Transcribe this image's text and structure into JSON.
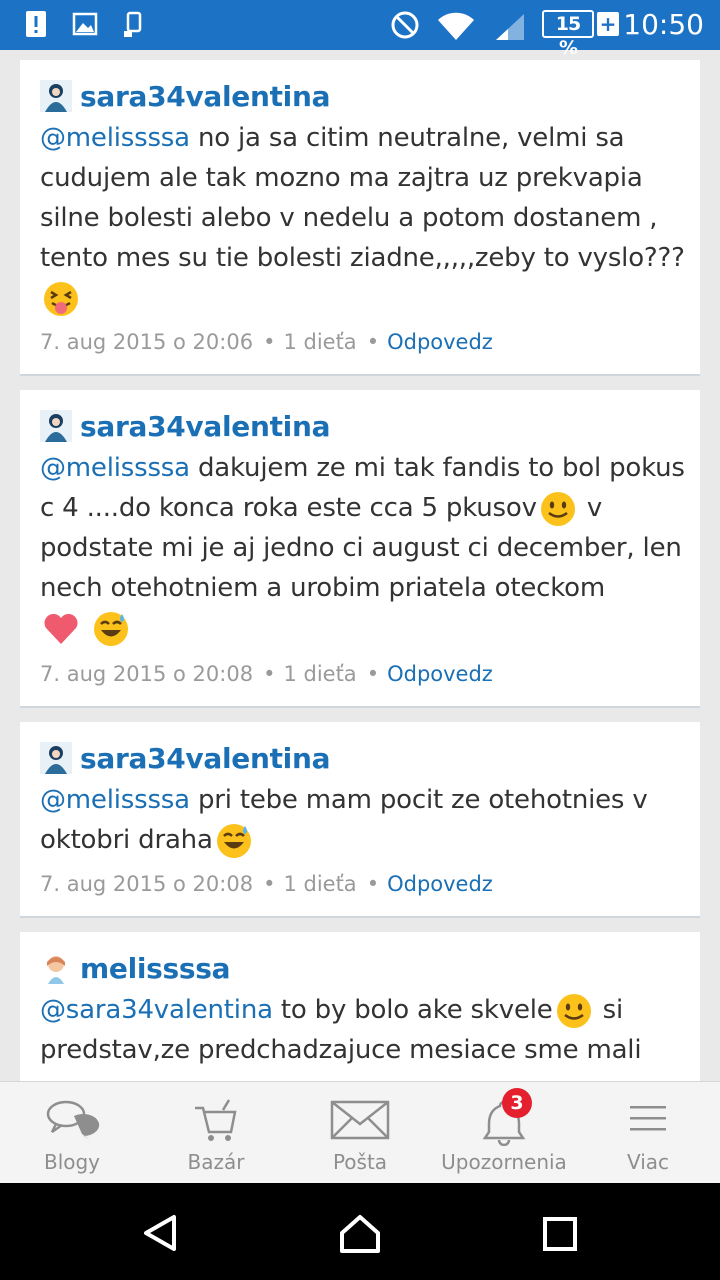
{
  "status_bar": {
    "time": "10:50",
    "battery": "15 %",
    "battery_plus": "+",
    "icons": [
      "alert-icon",
      "image-icon",
      "phone-transfer-icon",
      "do-not-disturb-icon",
      "wifi-icon",
      "signal-icon",
      "battery-icon"
    ]
  },
  "comments": [
    {
      "author": "sara34valentina",
      "mention": "@melissssa",
      "text": " no ja sa citim neutralne, velmi sa cudujem ale tak mozno ma zajtra uz prekvapia silne bolesti alebo v nedelu a potom dostanem , tento mes su tie bolesti ziadne,,,,,zeby to vyslo???",
      "emojis": [
        "tongue-out-emoji"
      ],
      "date": "7. aug 2015 o 20:06",
      "child": "1 dieťa",
      "reply": "Odpovedz"
    },
    {
      "author": "sara34valentina",
      "mention": "@melissssa",
      "text_a": " dakujem ze mi tak fandis to bol pokus c 4 ....do konca roka este cca 5 pkusov",
      "text_b": " v podstate mi je aj jedno ci august ci december, len nech otehotniem a urobim priatela oteckom",
      "emojis": [
        "smile-emoji",
        "heart-emoji",
        "sweat-smile-emoji"
      ],
      "date": "7. aug 2015 o 20:08",
      "child": "1 dieťa",
      "reply": "Odpovedz"
    },
    {
      "author": "sara34valentina",
      "mention": "@melissssa",
      "text": " pri tebe mam pocit ze otehotnies v oktobri draha",
      "emojis": [
        "sweat-smile-emoji"
      ],
      "date": "7. aug 2015 o 20:08",
      "child": "1 dieťa",
      "reply": "Odpovedz"
    },
    {
      "author": "melissssa",
      "mention": "@sara34valentina",
      "text_a": " to by bolo ake skvele",
      "text_b": " si predstav,ze predchadzajuce mesiace sme mali",
      "emojis": [
        "smile-emoji"
      ]
    }
  ],
  "tabs": [
    {
      "label": "Blogy",
      "icon": "chat-bubbles-icon"
    },
    {
      "label": "Bazár",
      "icon": "shopping-cart-icon"
    },
    {
      "label": "Pošta",
      "icon": "envelope-icon"
    },
    {
      "label": "Upozornenia",
      "icon": "bell-icon",
      "badge": "3"
    },
    {
      "label": "Viac",
      "icon": "hamburger-menu-icon"
    }
  ],
  "colors": {
    "status_bar": "#1c73c6",
    "link": "#1a6fb5",
    "badge": "#e5202e",
    "meta_text": "#9a9a9a"
  }
}
